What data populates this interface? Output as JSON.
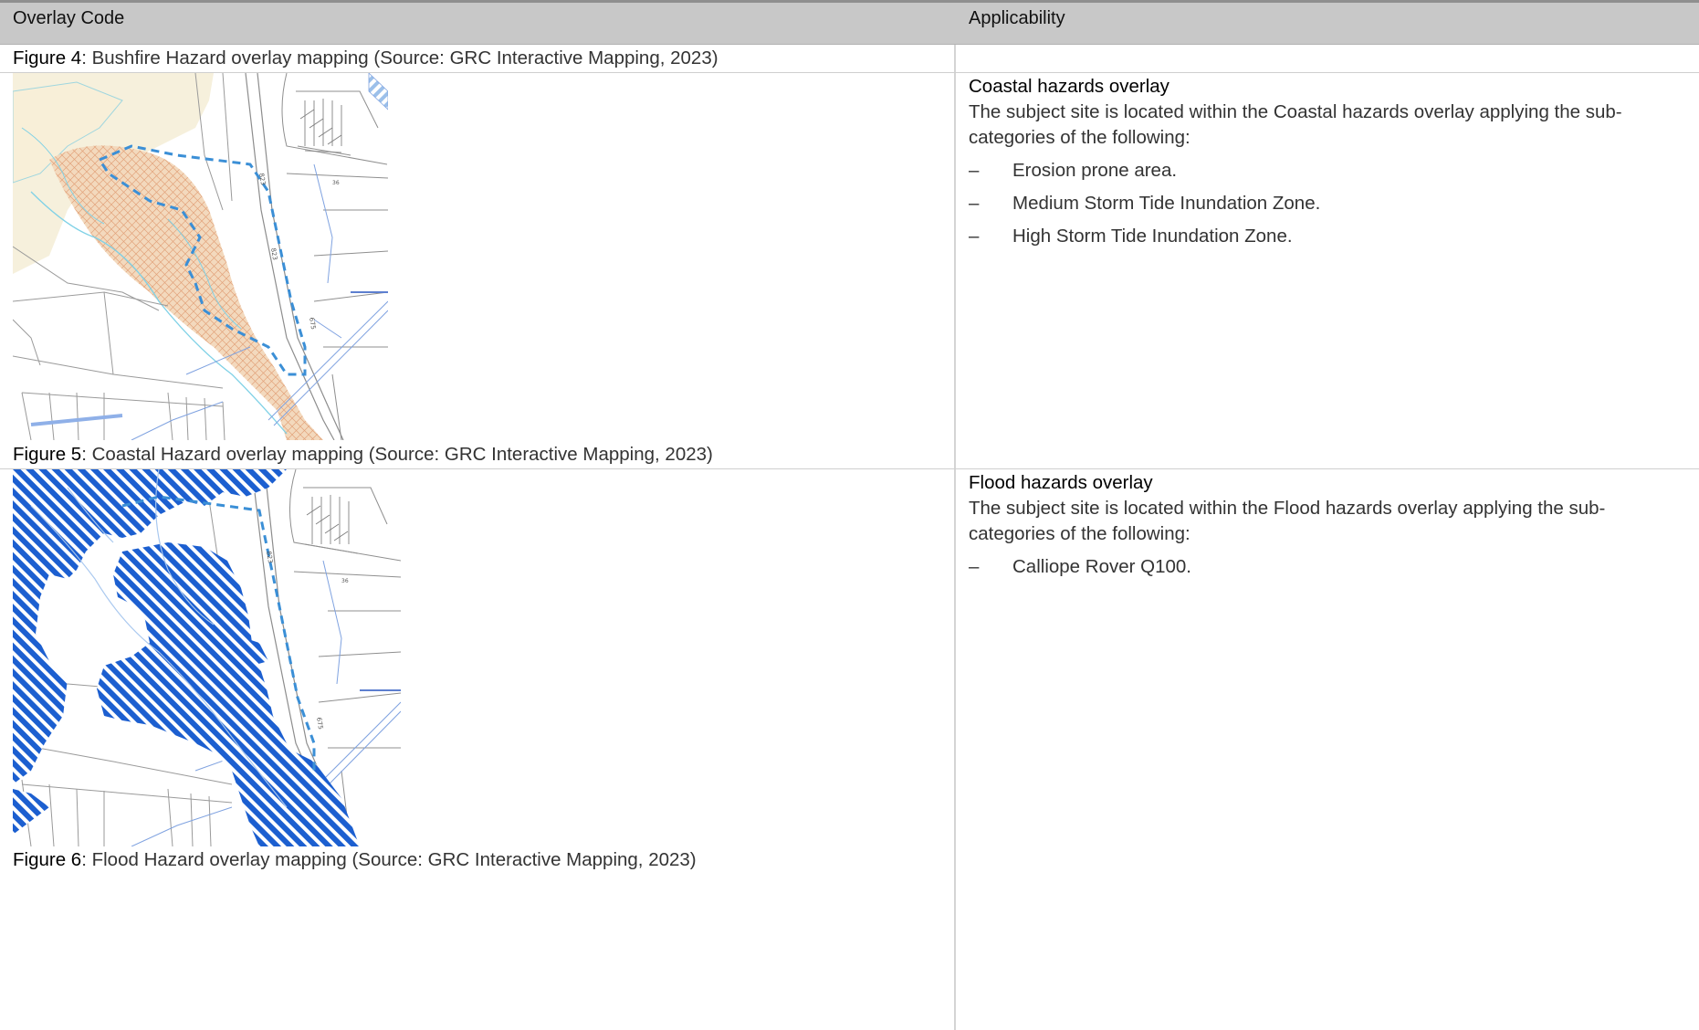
{
  "table": {
    "headers": {
      "col1": "Overlay Code",
      "col2": "Applicability"
    }
  },
  "figures": {
    "fig4": {
      "label": "Figure 4",
      "caption": ": Bushfire Hazard overlay mapping (Source: GRC Interactive Mapping, 2023)"
    },
    "fig5": {
      "label": "Figure 5",
      "caption": ": Coastal Hazard overlay mapping (Source: GRC Interactive Mapping, 2023)"
    },
    "fig6": {
      "label": "Figure 6",
      "caption": ": Flood Hazard overlay mapping (Source: GRC Interactive Mapping, 2023)"
    }
  },
  "map_labels": {
    "road_a": "823",
    "road_b": "675",
    "lot": "36"
  },
  "coastal": {
    "heading": "Coastal hazards overlay",
    "text": "The subject site is located within the Coastal hazards overlay applying the sub-categories of the following:",
    "bullet_char": "–",
    "items": [
      "Erosion prone area.",
      "Medium Storm Tide Inundation Zone.",
      "High Storm Tide Inundation Zone."
    ]
  },
  "flood": {
    "heading": "Flood hazards overlay",
    "text": "The subject site is located within the Flood hazards overlay applying the sub-categories of the following:",
    "bullet_char": "–",
    "items": [
      "Calliope Rover Q100."
    ]
  },
  "colors": {
    "header_bg": "#c8c8c8",
    "bushfire_fill": "#f3d9bd",
    "flood_hatch": "#1c5fd0",
    "site_boundary": "#3b8fd6"
  }
}
